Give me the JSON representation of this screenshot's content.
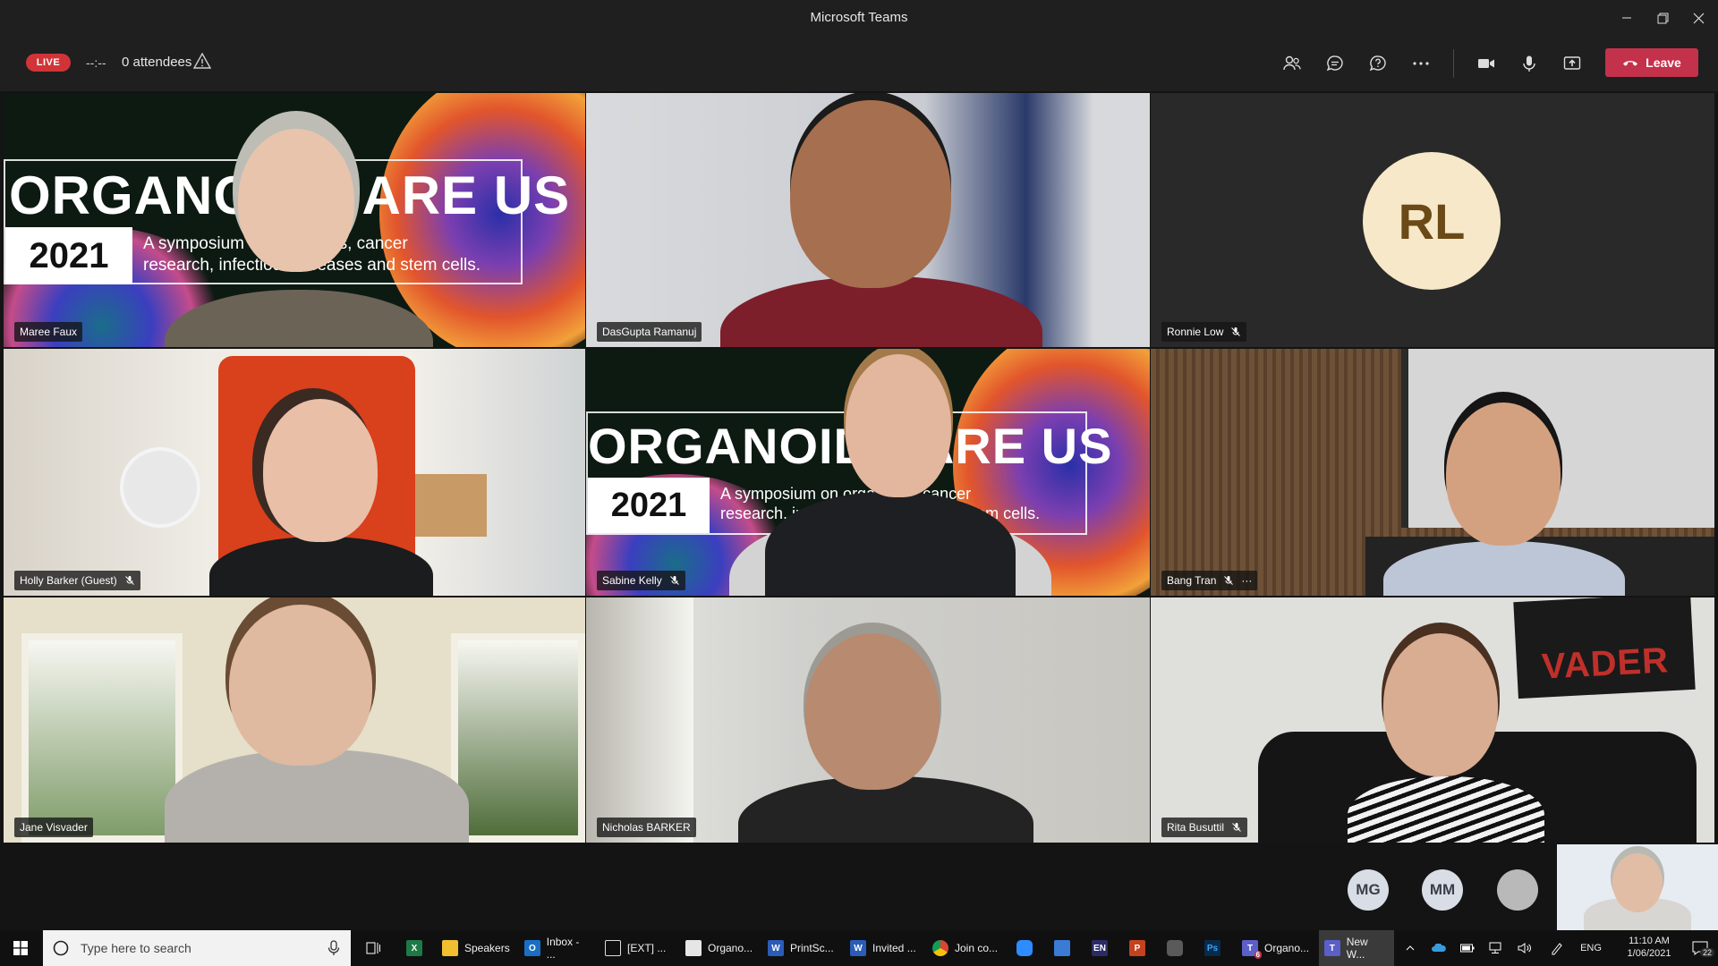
{
  "window": {
    "title": "Microsoft Teams"
  },
  "meeting": {
    "live_label": "LIVE",
    "timer": "--:--",
    "attendees": "0 attendees",
    "leave_label": "Leave"
  },
  "banner": {
    "word": "ORGANOIDS ARE US",
    "year": "2021",
    "subtitle_line1": "A symposium on organoids, cancer",
    "subtitle_line2": "research, infectious diseases and stem cells."
  },
  "participants": [
    {
      "name": "Maree Faux",
      "muted": false
    },
    {
      "name": "DasGupta Ramanuj",
      "muted": false
    },
    {
      "name": "Ronnie Low",
      "muted": true,
      "initials": "RL"
    },
    {
      "name": "Holly Barker (Guest)",
      "muted": true
    },
    {
      "name": "Sabine Kelly",
      "muted": true
    },
    {
      "name": "Bang Tran",
      "muted": true,
      "more": "···"
    },
    {
      "name": "Jane Visvader",
      "muted": false
    },
    {
      "name": "Nicholas BARKER",
      "muted": false
    },
    {
      "name": "Rita Busuttil",
      "muted": true
    }
  ],
  "vader_sign": "VADER",
  "roster": [
    {
      "initials": "MG"
    },
    {
      "initials": "MM"
    },
    {
      "initials": ""
    }
  ],
  "taskbar": {
    "search_placeholder": "Type here to search",
    "apps": [
      {
        "label": "Speakers"
      },
      {
        "label": "Inbox - ..."
      },
      {
        "label": "[EXT] ..."
      },
      {
        "label": "Organo..."
      },
      {
        "label": "PrintSc..."
      },
      {
        "label": "Invited ..."
      },
      {
        "label": "Join co..."
      },
      {
        "label": "Organo..."
      },
      {
        "label": "New W..."
      }
    ],
    "lang": "ENG",
    "time": "11:10 AM",
    "date": "1/06/2021",
    "notifications": "22",
    "en_badge": "EN",
    "ps_badge": "Ps",
    "teams_badge": "6"
  },
  "colors": {
    "leave": "#c4314b",
    "live": "#d13438",
    "avatar_rl": "#f6e8c8"
  }
}
